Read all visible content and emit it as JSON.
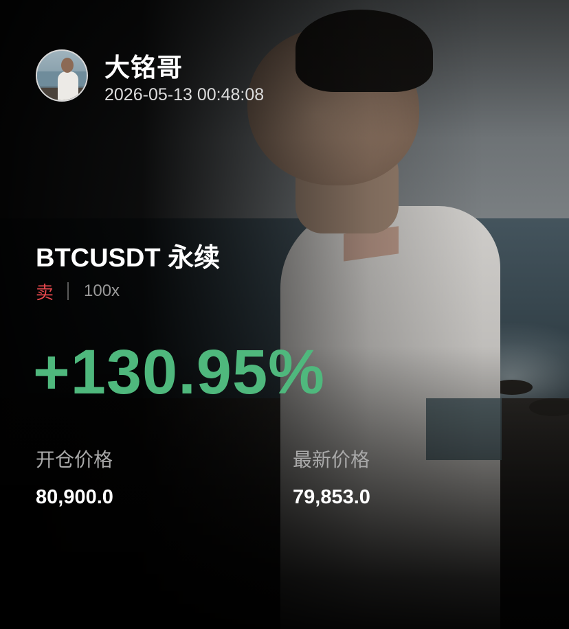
{
  "user": {
    "name": "大铭哥",
    "timestamp": "2026-05-13 00:48:08"
  },
  "position": {
    "symbol": "BTCUSDT 永续",
    "side": "卖",
    "leverage": "100x",
    "pnl_percent": "+130.95%"
  },
  "prices": {
    "entry_label": "开仓价格",
    "entry_value": "80,900.0",
    "last_label": "最新价格",
    "last_value": "79,853.0"
  },
  "colors": {
    "profit": "#4fb87d",
    "sell": "#e5484d",
    "background": "#060606"
  },
  "icons": {
    "avatar": "user-avatar-photo"
  }
}
